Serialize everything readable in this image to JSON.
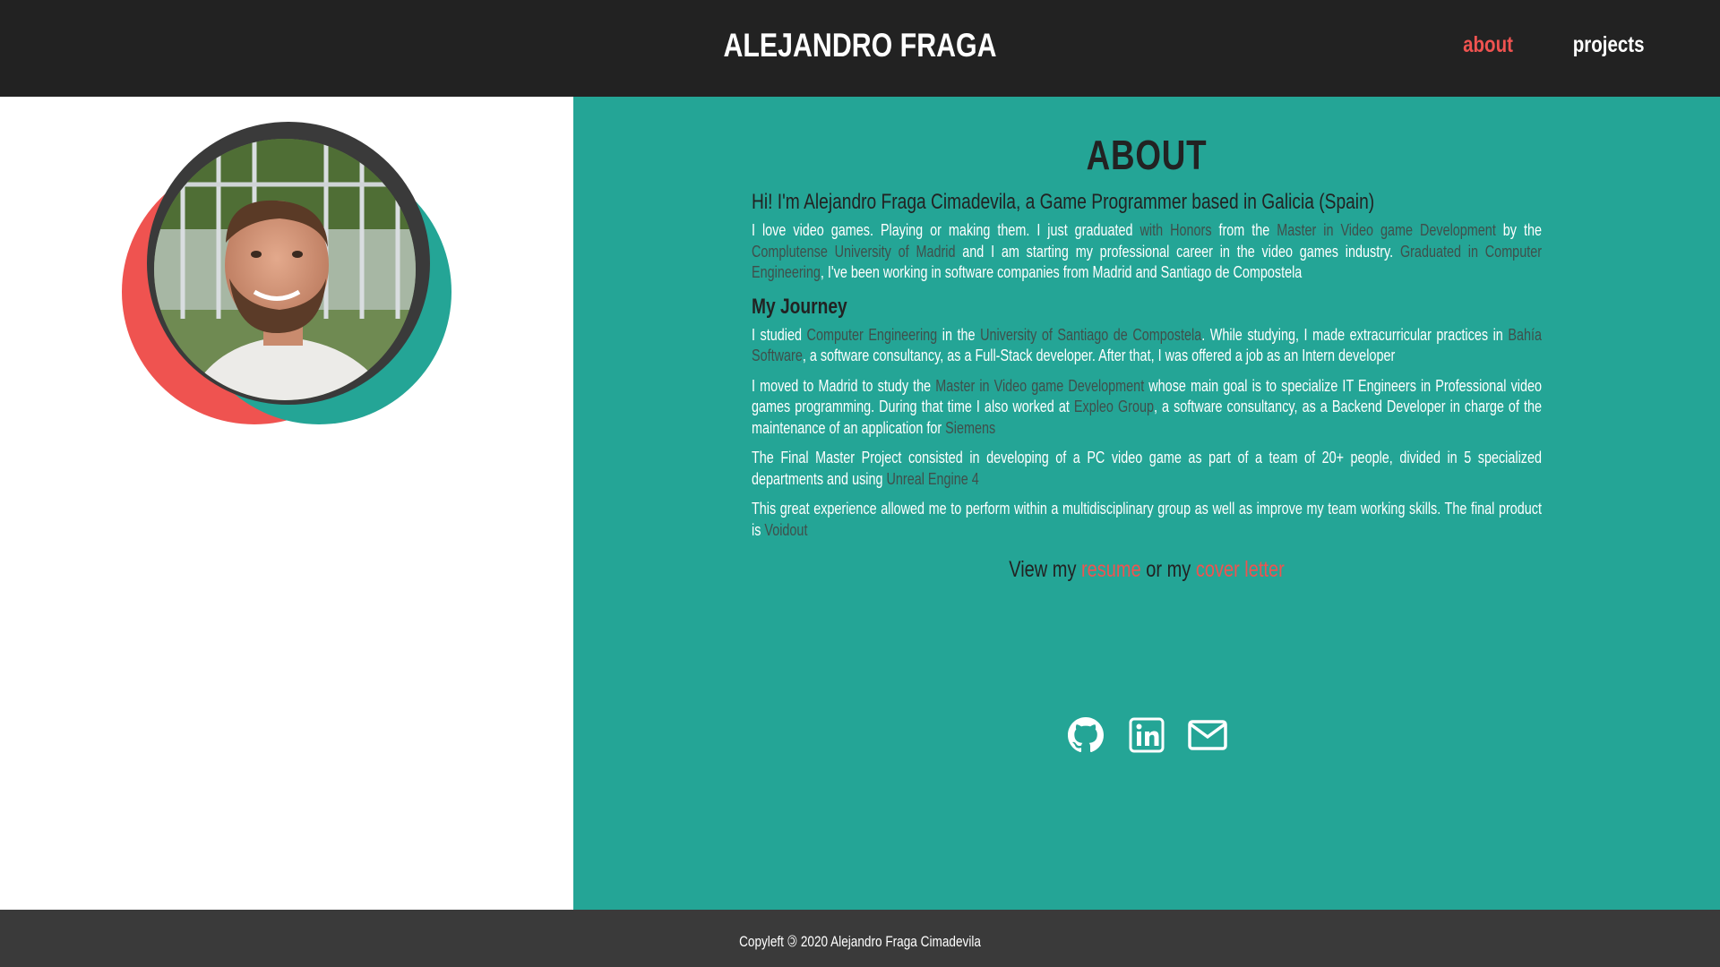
{
  "header": {
    "title": "ALEJANDRO FRAGA",
    "nav": [
      {
        "label": "about",
        "active": true
      },
      {
        "label": "projects",
        "active": false
      }
    ]
  },
  "colors": {
    "header_bg": "#222222",
    "teal": "#24a596",
    "accent_red": "#ef5350",
    "footer_bg": "#3a3a3a"
  },
  "about": {
    "title": "ABOUT",
    "intro_heading": "Hi! I'm Alejandro Fraga Cimadevila, a Game Programmer based in Galicia (Spain)",
    "intro": {
      "t1": "I love video games. Playing or making them. I just graduated ",
      "h1": "with Honors",
      "t2": " from the ",
      "h2": "Master in Video game Development",
      "t3": " by the ",
      "h3": "Complutense University of Madrid",
      "t4": " and I am starting my professional career in the video games industry. ",
      "h4": "Graduated in Computer Engineering",
      "t5": ", I've been working in software companies from Madrid and Santiago de Compostela"
    },
    "journey_heading": "My Journey",
    "p1": {
      "t1": "I studied ",
      "h1": "Computer Engineering",
      "t2": " in the ",
      "h2": "University of Santiago de Compostela",
      "t3": ". While studying, I made extracurricular practices in ",
      "h3": "Bahía Software",
      "t4": ", a software consultancy, as a Full-Stack developer. After that, I was offered a job as an Intern developer"
    },
    "p2": {
      "t1": "I moved to Madrid to study the ",
      "h1": "Master in Video game Development",
      "t2": " whose main goal is to specialize IT Engineers in Professional video games programming. During that time I also worked at ",
      "h2": "Expleo Group",
      "t3": ", a software consultancy, as a Backend Developer in charge of the maintenance of an application for ",
      "h3": "Siemens"
    },
    "p3": {
      "t1": "The Final Master Project consisted in developing of a PC video game as part of a team of 20+ people, divided in 5 specialized departments and using ",
      "h1": "Unreal Engine 4"
    },
    "p4": {
      "t1": "This great experience allowed me to perform within a multidisciplinary group as well as improve my team working skills. The final product is ",
      "h1": "Voidout"
    },
    "cv": {
      "t1": "View my ",
      "resume": "resume",
      "t2": " or my ",
      "cover": "cover letter"
    }
  },
  "socials": [
    {
      "icon": "github-icon"
    },
    {
      "icon": "linkedin-icon"
    },
    {
      "icon": "mail-icon"
    }
  ],
  "footer": {
    "text": "Copyleft 🄯 2020 Alejandro Fraga Cimadevila"
  }
}
